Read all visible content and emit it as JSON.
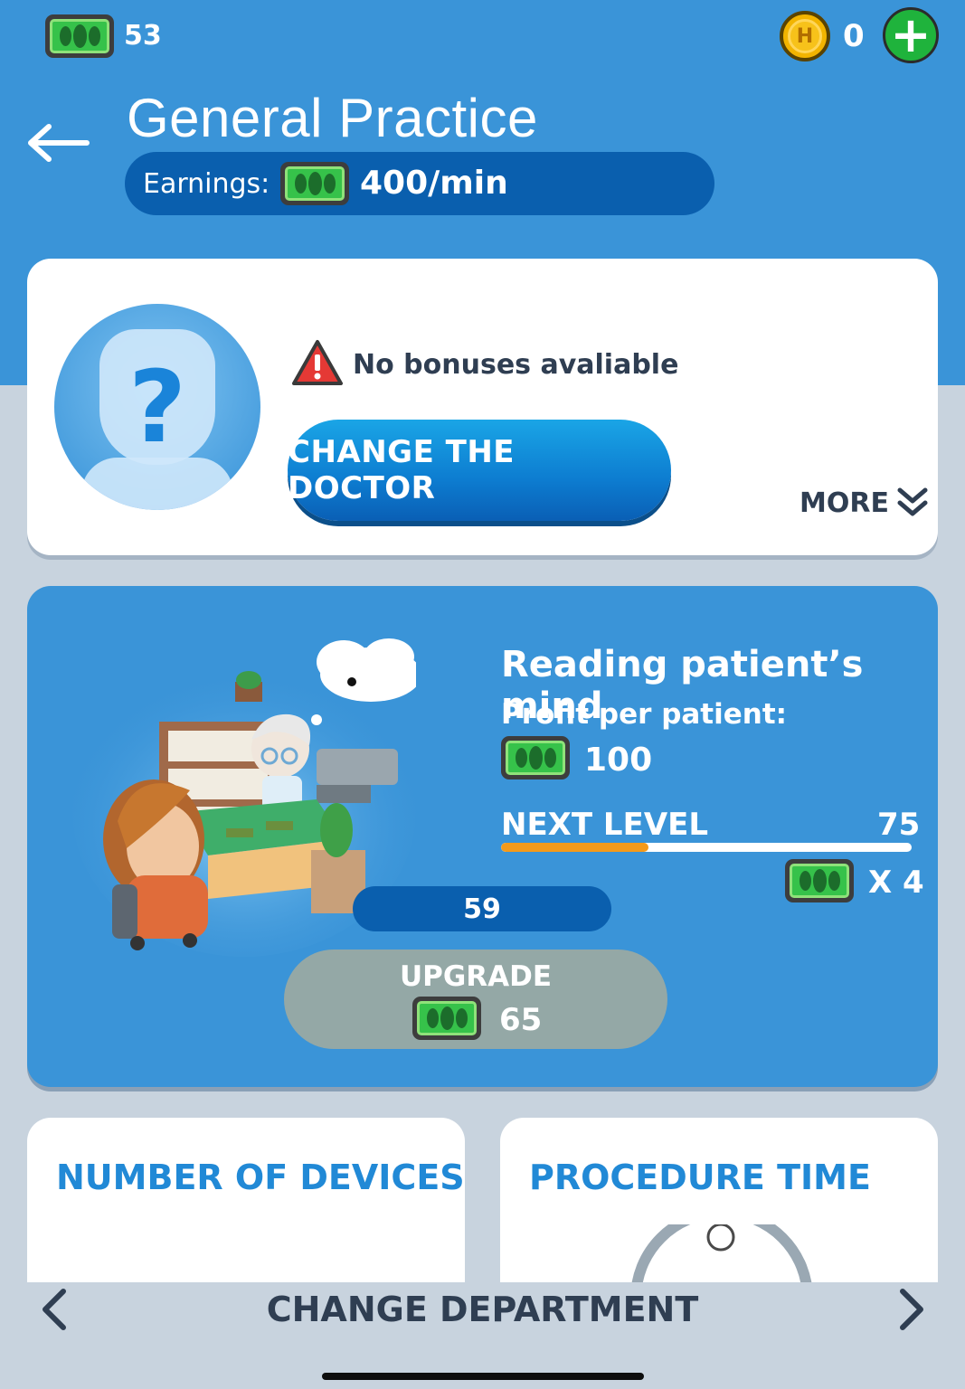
{
  "topbar": {
    "cash_icon": "cash-bill-icon",
    "cash_count": "53",
    "coin_icon": "h-coin-icon",
    "coin_letter": "H",
    "coin_count": "0",
    "add_icon": "plus-icon"
  },
  "header": {
    "back_icon": "back-arrow-icon",
    "title": "General Practice",
    "earnings_label": "Earnings:",
    "earnings_value": "400/min"
  },
  "doctor": {
    "avatar_icon": "unknown-doctor-icon",
    "avatar_symbol": "?",
    "warning_icon": "warning-triangle-icon",
    "bonus_text": "No bonuses avaliable",
    "change_button": "CHANGE THE DOCTOR",
    "more_label": "MORE"
  },
  "skill": {
    "title": "Reading patient’s mind",
    "profit_label": "Profit per patient:",
    "profit_value": "100",
    "next_level_label": "NEXT LEVEL",
    "next_level_value": "75",
    "progress": 0.36,
    "multiplier": "X 4",
    "count": "59",
    "upgrade_label": "UPGRADE",
    "upgrade_cost": "65"
  },
  "stats": {
    "devices_title": "NUMBER OF DEVICES",
    "procedure_title": "PROCEDURE TIME"
  },
  "footer": {
    "change_department": "CHANGE DEPARTMENT"
  },
  "colors": {
    "header_blue": "#3a94d8",
    "dark_pill": "#0a5fae",
    "cash_green": "#36c24a",
    "progress_orange": "#f49a1a",
    "stat_title_blue": "#2189d6",
    "upgrade_disabled": "#94a8a6"
  }
}
